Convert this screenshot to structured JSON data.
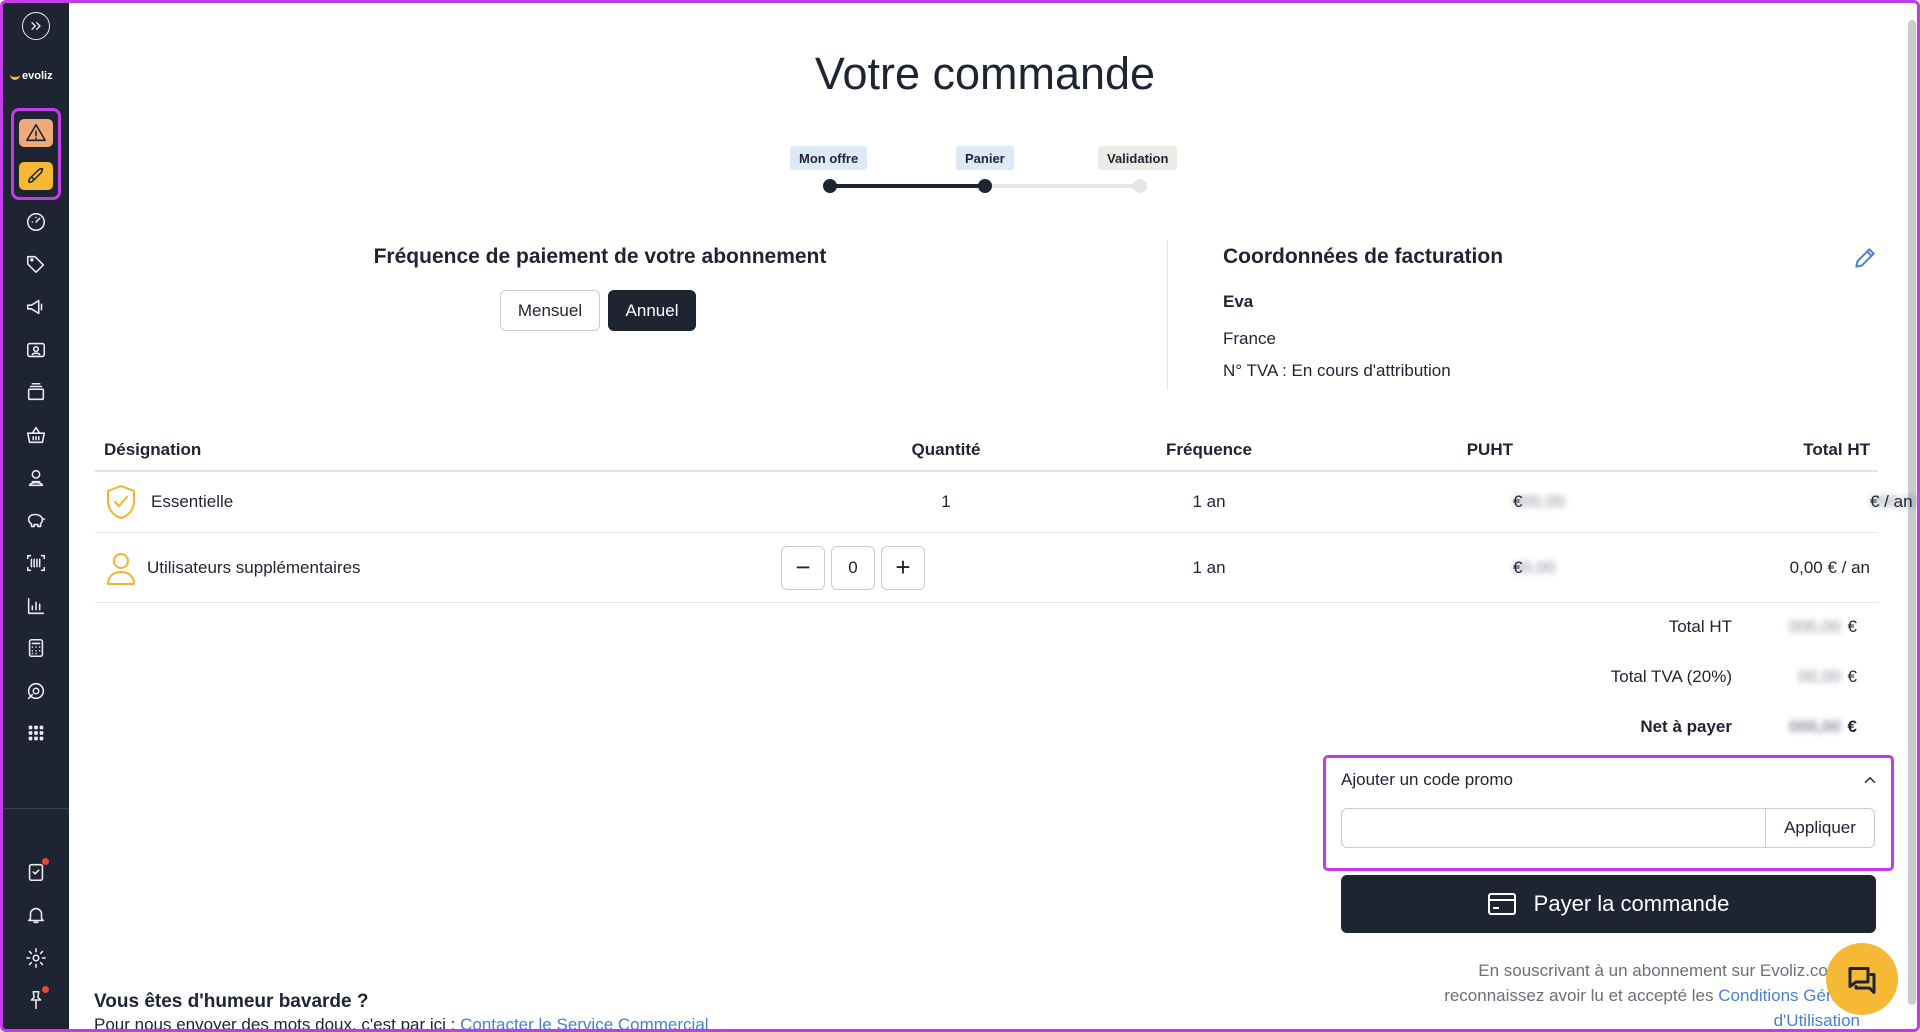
{
  "sidebar": {
    "logo_text": "evoliz",
    "items": [
      {
        "icon": "expand-icon"
      },
      {
        "icon": "alert-icon"
      },
      {
        "icon": "rocket-icon"
      },
      {
        "icon": "dashboard-icon"
      },
      {
        "icon": "tag-icon"
      },
      {
        "icon": "megaphone-icon"
      },
      {
        "icon": "contacts-icon"
      },
      {
        "icon": "archive-icon"
      },
      {
        "icon": "basket-icon"
      },
      {
        "icon": "user-icon"
      },
      {
        "icon": "piggy-bank-icon"
      },
      {
        "icon": "barcode-icon"
      },
      {
        "icon": "chart-icon"
      },
      {
        "icon": "calculator-icon"
      },
      {
        "icon": "support-icon"
      },
      {
        "icon": "apps-icon"
      },
      {
        "icon": "tasks-icon"
      },
      {
        "icon": "bell-icon"
      },
      {
        "icon": "settings-icon"
      },
      {
        "icon": "pin-icon"
      }
    ],
    "accent": "#f5b935",
    "alert_color": "#f0a97a"
  },
  "page": {
    "title": "Votre commande"
  },
  "stepper": {
    "steps": [
      "Mon offre",
      "Panier",
      "Validation"
    ],
    "current": 2
  },
  "frequency": {
    "title": "Fréquence de paiement de votre abonnement",
    "options": [
      "Mensuel",
      "Annuel"
    ],
    "selected": "Annuel"
  },
  "billing": {
    "title": "Coordonnées de facturation",
    "name": "Eva",
    "country": "France",
    "tva": "N° TVA : En cours d'attribution"
  },
  "table": {
    "headers": {
      "designation": "Désignation",
      "quantity": "Quantité",
      "frequency": "Fréquence",
      "puht": "PUHT",
      "total": "Total HT"
    },
    "rows": [
      {
        "designation": "Essentielle",
        "quantity": "1",
        "frequency": "1 an",
        "puht_blurred": "000,00",
        "puht_suffix": "€",
        "total_blurred": "000,00",
        "total_suffix": "€ / an"
      },
      {
        "designation": "Utilisateurs supplémentaires",
        "quantity": "0",
        "frequency": "1 an",
        "puht_blurred": "00,00",
        "puht_suffix": "€",
        "total": "0,00 € / an"
      }
    ],
    "minus": "−",
    "plus": "+"
  },
  "totals": {
    "ht_label": "Total HT",
    "ht_blurred": "000,00",
    "tva_label": "Total TVA (20%)",
    "tva_blurred": "00,00",
    "net_label": "Net à payer",
    "net_blurred": "000,00",
    "currency": "€"
  },
  "promo": {
    "header": "Ajouter un code promo",
    "input_value": "",
    "apply": "Appliquer"
  },
  "pay": {
    "label": "Payer la commande"
  },
  "legal": {
    "line1": "En souscrivant à un abonnement sur Evoliz.com, v",
    "line2_text": "reconnaissez avoir lu et accepté les ",
    "line2_link": "Conditions Généra",
    "line3_link": "d'Utilisation"
  },
  "chat": {
    "title": "Vous êtes d'humeur bavarde ?",
    "text": "Pour nous envoyer des mots doux, c'est par ici : ",
    "link": "Contacter le Service Commercial"
  }
}
